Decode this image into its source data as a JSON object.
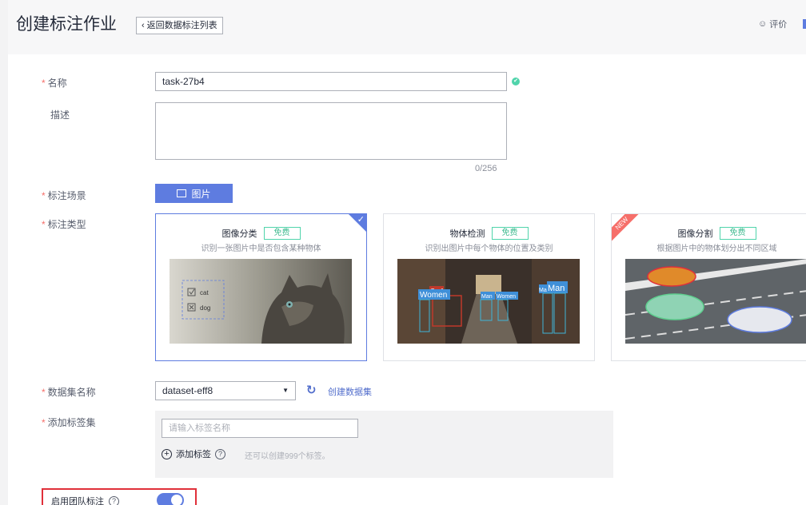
{
  "header": {
    "title": "创建标注作业",
    "back_label": "返回数据标注列表",
    "rate_label": "评价"
  },
  "form": {
    "name": {
      "label": "名称",
      "value": "task-27b4"
    },
    "description": {
      "label": "描述",
      "counter": "0/256"
    },
    "scene": {
      "label": "标注场景",
      "button_label": "图片"
    },
    "type": {
      "label": "标注类型",
      "cards": [
        {
          "title": "图像分类",
          "badge": "免费",
          "desc": "识别一张图片中是否包含某种物体",
          "selected": true,
          "options": [
            "cat",
            "dog"
          ]
        },
        {
          "title": "物体检测",
          "badge": "免费",
          "desc": "识别出图片中每个物体的位置及类别",
          "boxes": [
            "Car1",
            "Women",
            "Man",
            "Women",
            "Ma",
            "Man"
          ]
        },
        {
          "title": "图像分割",
          "badge": "免费",
          "desc": "根据图片中的物体划分出不同区域",
          "ribbon": "NEW"
        }
      ]
    },
    "dataset": {
      "label": "数据集名称",
      "value": "dataset-eff8",
      "create_link": "创建数据集"
    },
    "tags": {
      "label": "添加标签集",
      "placeholder": "请输入标签名称",
      "add_label": "添加标签",
      "remain_text": "还可以创建999个标签。"
    },
    "team": {
      "label": "启用团队标注",
      "enabled": true
    }
  },
  "colors": {
    "accent": "#5e7ce0",
    "success": "#50d4ab",
    "required": "#f66f6a",
    "highlight": "#e0303a"
  }
}
